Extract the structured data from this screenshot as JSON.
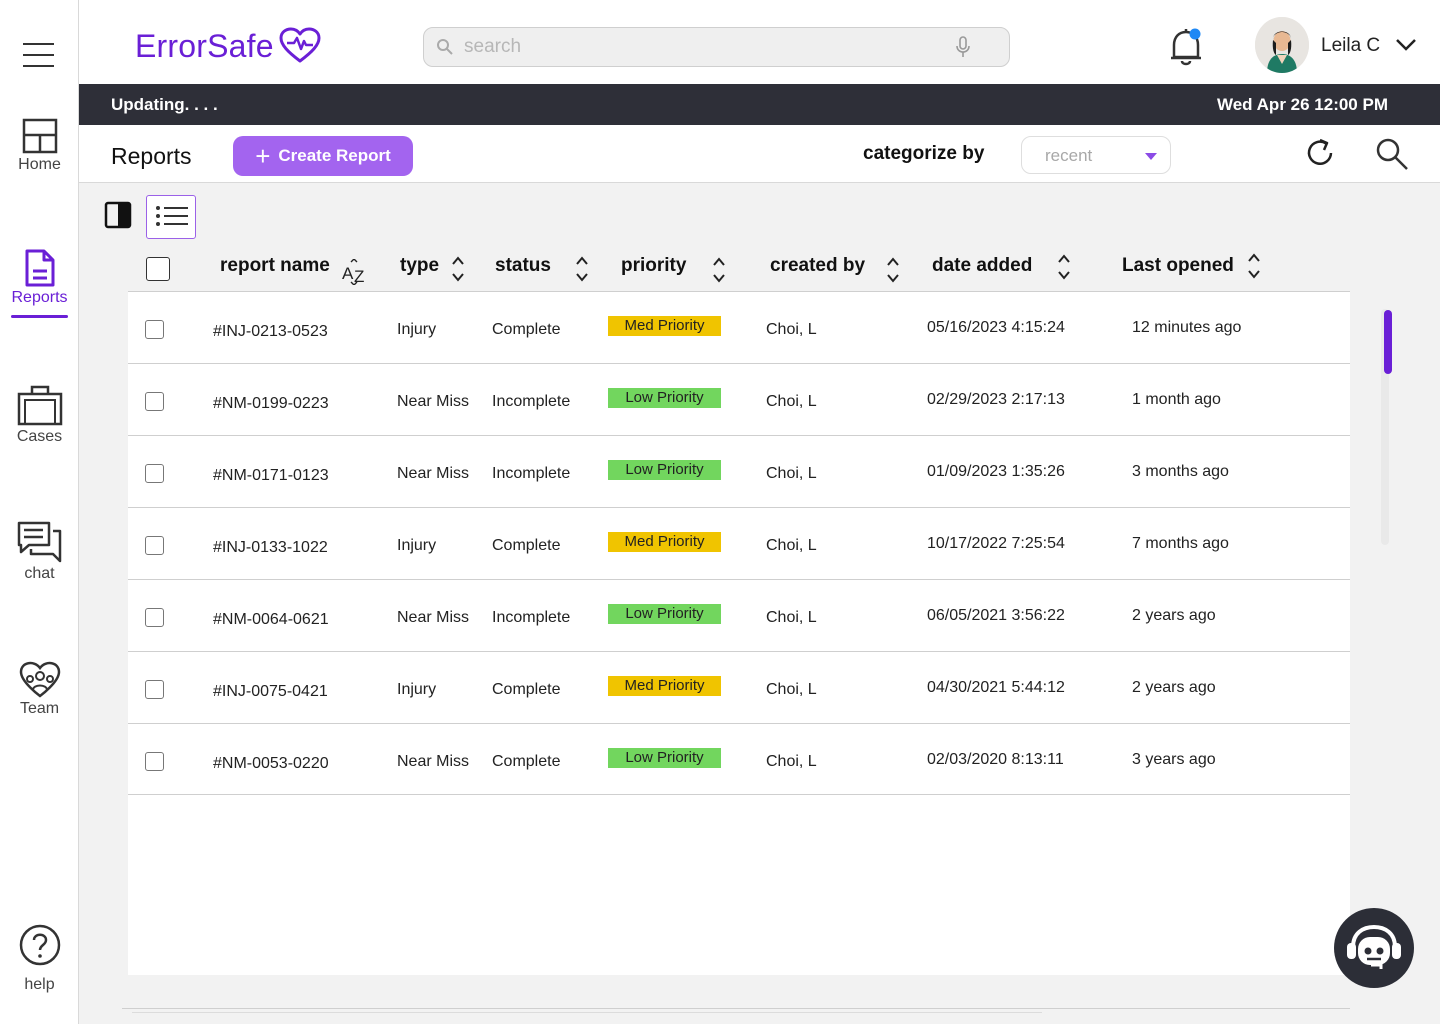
{
  "app": {
    "name": "ErrorSafe"
  },
  "sidebar": {
    "items": [
      {
        "label": "Home",
        "icon": "home-icon"
      },
      {
        "label": "Reports",
        "icon": "document-icon",
        "active": true
      },
      {
        "label": "Cases",
        "icon": "briefcase-icon"
      },
      {
        "label": "chat",
        "icon": "chat-icon"
      },
      {
        "label": "Team",
        "icon": "team-icon"
      },
      {
        "label": "help",
        "icon": "help-icon"
      }
    ]
  },
  "header": {
    "search_placeholder": "search",
    "user_name": "Leila C"
  },
  "status": {
    "left": "Updating. . . .",
    "right": "Wed Apr 26 12:00 PM"
  },
  "toolbar": {
    "title": "Reports",
    "create_label": "Create Report",
    "categorize_label": "categorize by",
    "categorize_value": "recent"
  },
  "table": {
    "columns": [
      "report name",
      "type",
      "status",
      "priority",
      "created by",
      "date added",
      "Last opened"
    ],
    "rows": [
      {
        "name": "#INJ-0213-0523",
        "type": "Injury",
        "status": "Complete",
        "priority": "Med Priority",
        "created_by": "Choi, L",
        "date_added": "05/16/2023 4:15:24",
        "last_opened": "12 minutes ago"
      },
      {
        "name": "#NM-0199-0223",
        "type": "Near Miss",
        "status": "Incomplete",
        "priority": "Low Priority",
        "created_by": "Choi, L",
        "date_added": "02/29/2023 2:17:13",
        "last_opened": "1 month ago"
      },
      {
        "name": "#NM-0171-0123",
        "type": "Near Miss",
        "status": "Incomplete",
        "priority": "Low Priority",
        "created_by": "Choi, L",
        "date_added": "01/09/2023 1:35:26",
        "last_opened": "3 months ago"
      },
      {
        "name": "#INJ-0133-1022",
        "type": "Injury",
        "status": "Complete",
        "priority": "Med Priority",
        "created_by": "Choi, L",
        "date_added": "10/17/2022 7:25:54",
        "last_opened": "7 months ago"
      },
      {
        "name": "#NM-0064-0621",
        "type": "Near Miss",
        "status": "Incomplete",
        "priority": "Low Priority",
        "created_by": "Choi, L",
        "date_added": "06/05/2021 3:56:22",
        "last_opened": "2 years ago"
      },
      {
        "name": "#INJ-0075-0421",
        "type": "Injury",
        "status": "Complete",
        "priority": "Med Priority",
        "created_by": "Choi, L",
        "date_added": "04/30/2021 5:44:12",
        "last_opened": "2 years ago"
      },
      {
        "name": "#NM-0053-0220",
        "type": "Near Miss",
        "status": "Complete",
        "priority": "Low Priority",
        "created_by": "Choi, L",
        "date_added": "02/03/2020 8:13:11",
        "last_opened": "3 years ago"
      }
    ]
  },
  "colors": {
    "brand": "#6a1fd6",
    "button": "#a364ef",
    "med_priority": "#f0c400",
    "low_priority": "#72d65e",
    "status_bar": "#2e2f38",
    "notification_dot": "#1e88f5"
  }
}
